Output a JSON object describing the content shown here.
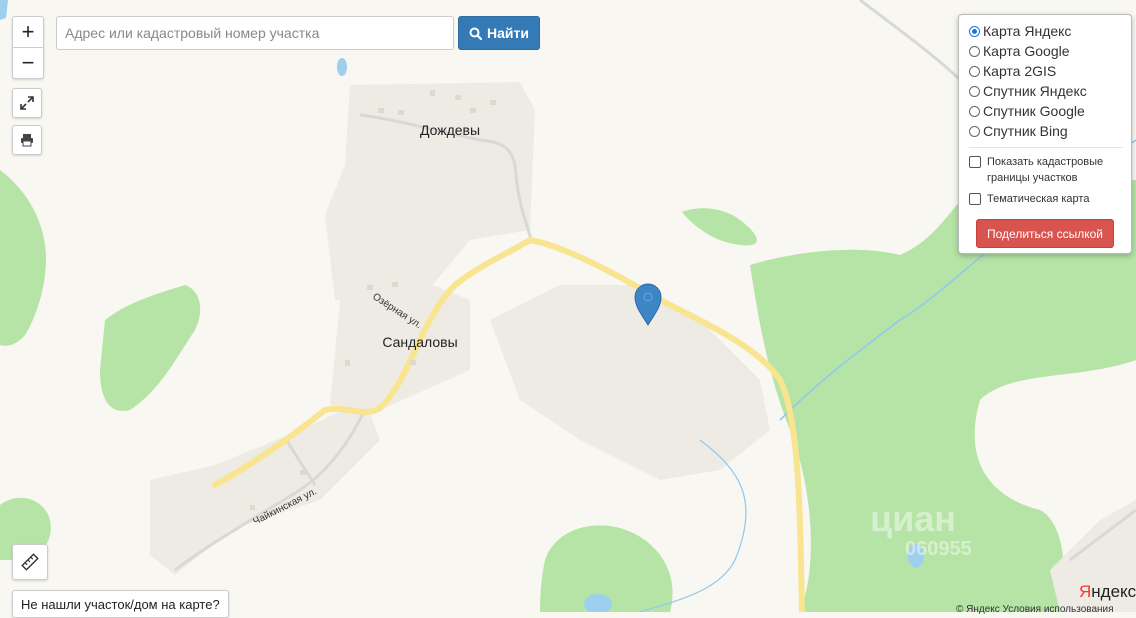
{
  "search": {
    "placeholder": "Адрес или кадастровый номер участка",
    "button_label": "Найти"
  },
  "zoom": {
    "in_label": "+",
    "out_label": "−"
  },
  "icons": {
    "fullscreen": "expand-arrows-icon",
    "print": "printer-icon",
    "ruler": "ruler-icon",
    "search": "magnifier-icon",
    "marker": "map-pin-icon"
  },
  "layers": {
    "options": [
      {
        "label": "Карта Яндекс",
        "checked": true
      },
      {
        "label": "Карта Google",
        "checked": false
      },
      {
        "label": "Карта 2GIS",
        "checked": false
      },
      {
        "label": "Спутник Яндекс",
        "checked": false
      },
      {
        "label": "Спутник Google",
        "checked": false
      },
      {
        "label": "Спутник Bing",
        "checked": false
      }
    ],
    "cadastral_label": "Показать кадастровые границы участков",
    "thematic_label": "Тематическая карта",
    "share_label": "Поделиться ссылкой"
  },
  "map_labels": {
    "village_top": "Дождевы",
    "village_main": "Сандаловы",
    "street_ozernaya": "Озёрная ул.",
    "street_chaykinskaya": "Чайкинская ул."
  },
  "footer": {
    "not_found": "Не нашли участок/дом на карте?",
    "copyright": "© Яндекс  Условия использования",
    "logo_first": "Я",
    "logo_rest": "ндекс"
  },
  "watermark": {
    "line1": "циан",
    "line2": "060955"
  },
  "colors": {
    "forest": "#aee3a0",
    "road": "#f9e59a",
    "settlement": "#f0ede6",
    "water": "#9ed0f2",
    "marker": "#3d86c6",
    "primary": "#337ab7",
    "danger": "#d9534f"
  }
}
